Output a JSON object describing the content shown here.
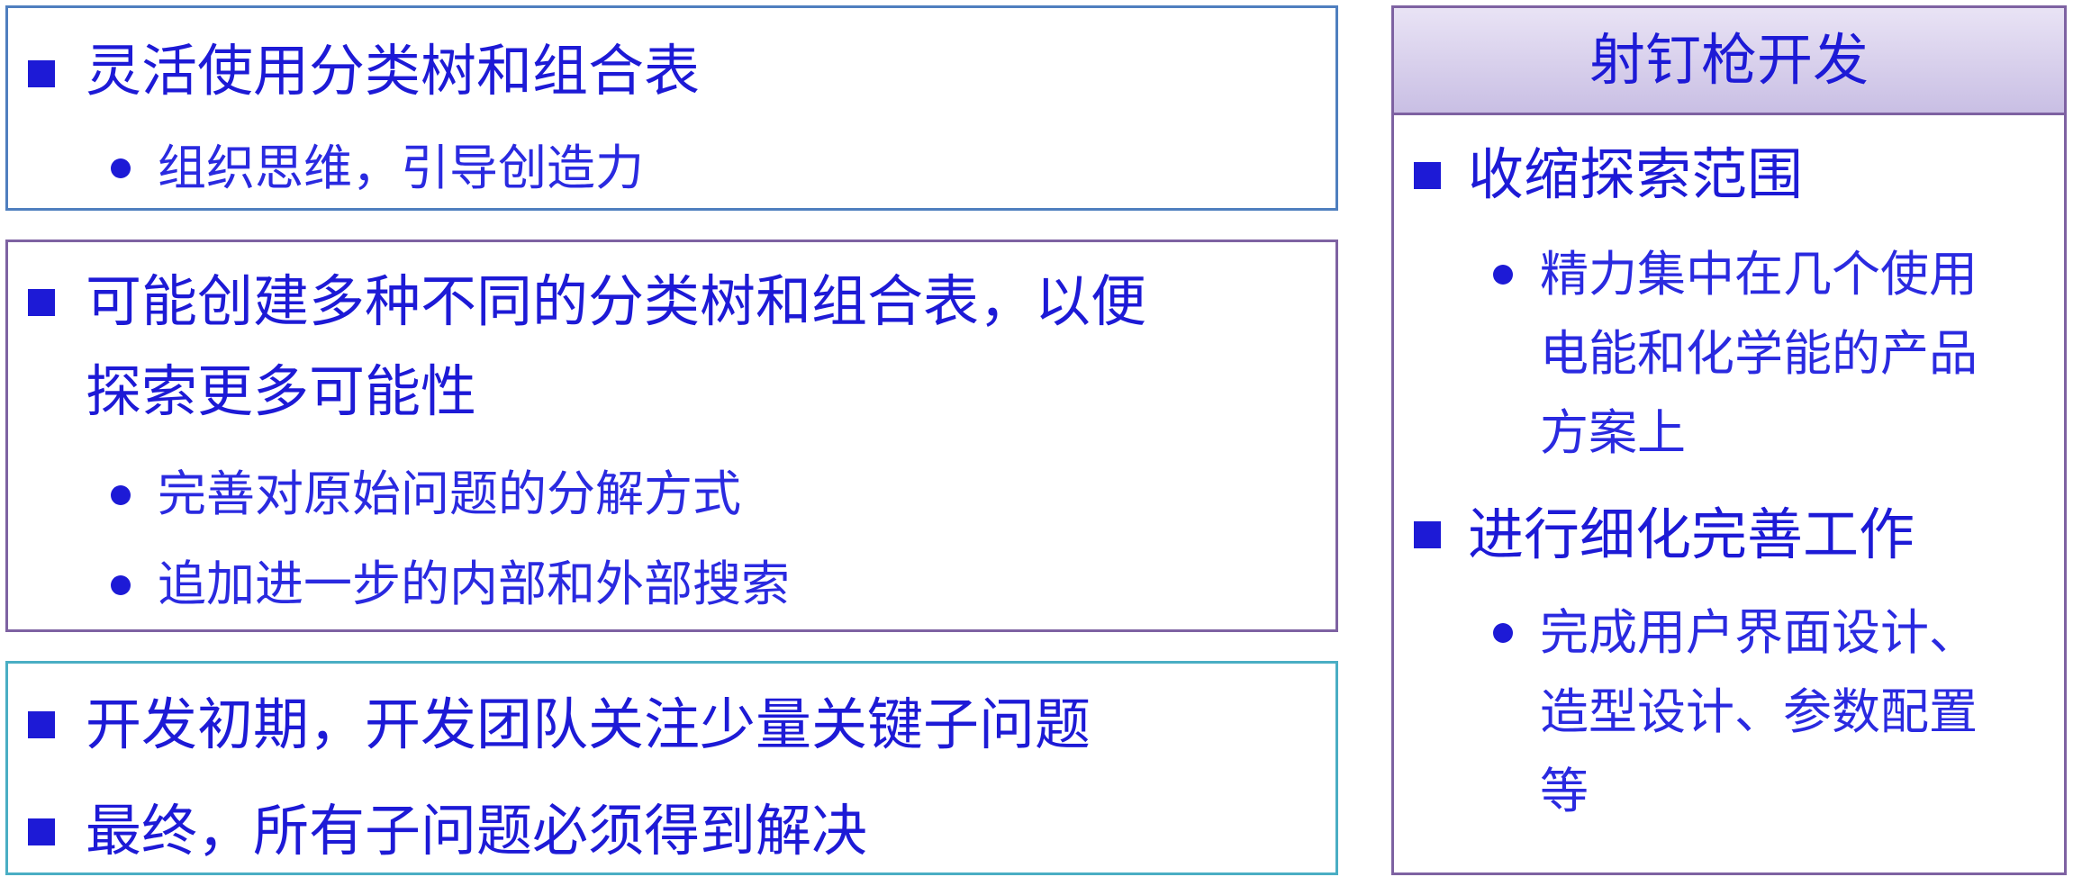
{
  "box1": {
    "bullet1": "灵活使用分类树和组合表",
    "sub1": "组织思维，引导创造力"
  },
  "box2": {
    "bullet1_line1": "可能创建多种不同的分类树和组合表，以便",
    "bullet1_line2": "探索更多可能性",
    "sub1": "完善对原始问题的分解方式",
    "sub2": "追加进一步的内部和外部搜索"
  },
  "box3": {
    "bullet1": "开发初期，开发团队关注少量关键子问题",
    "bullet2": "最终，所有子问题必须得到解决"
  },
  "sidebar": {
    "title": "射钉枪开发",
    "bullet1": "收缩探索范围",
    "sub1_line1": "精力集中在几个使用",
    "sub1_line2": "电能和化学能的产品",
    "sub1_line3": "方案上",
    "bullet2": "进行细化完善工作",
    "sub2_line1": "完成用户界面设计、",
    "sub2_line2": "造型设计、参数配置",
    "sub2_line3": "等"
  },
  "colors": {
    "text": "#1d1ad6",
    "border_blue": "#4f7fbf",
    "border_purple": "#7e62a2",
    "border_teal": "#4aaec4",
    "header_gradient_top": "#e9e3f5",
    "header_gradient_bottom": "#c9bfe4"
  }
}
